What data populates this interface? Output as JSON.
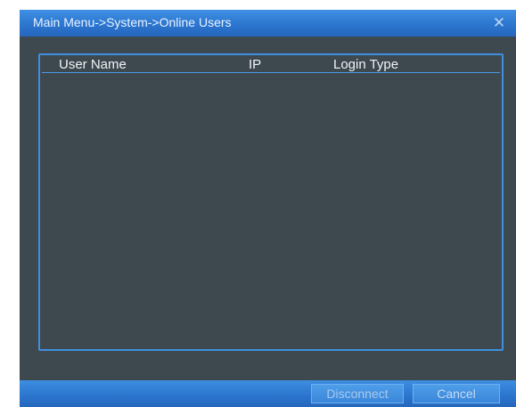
{
  "dialog": {
    "title": "Main Menu->System->Online Users",
    "close_glyph": "✕"
  },
  "table": {
    "columns": [
      "User Name",
      "IP",
      "Login Type"
    ],
    "rows": []
  },
  "footer": {
    "disconnect_label": "Disconnect",
    "cancel_label": "Cancel"
  },
  "colors": {
    "titlebar": "#2c76cf",
    "panel_background": "#3e484f",
    "table_border": "#3f8fde"
  },
  "icons": {
    "close": "close-icon"
  }
}
